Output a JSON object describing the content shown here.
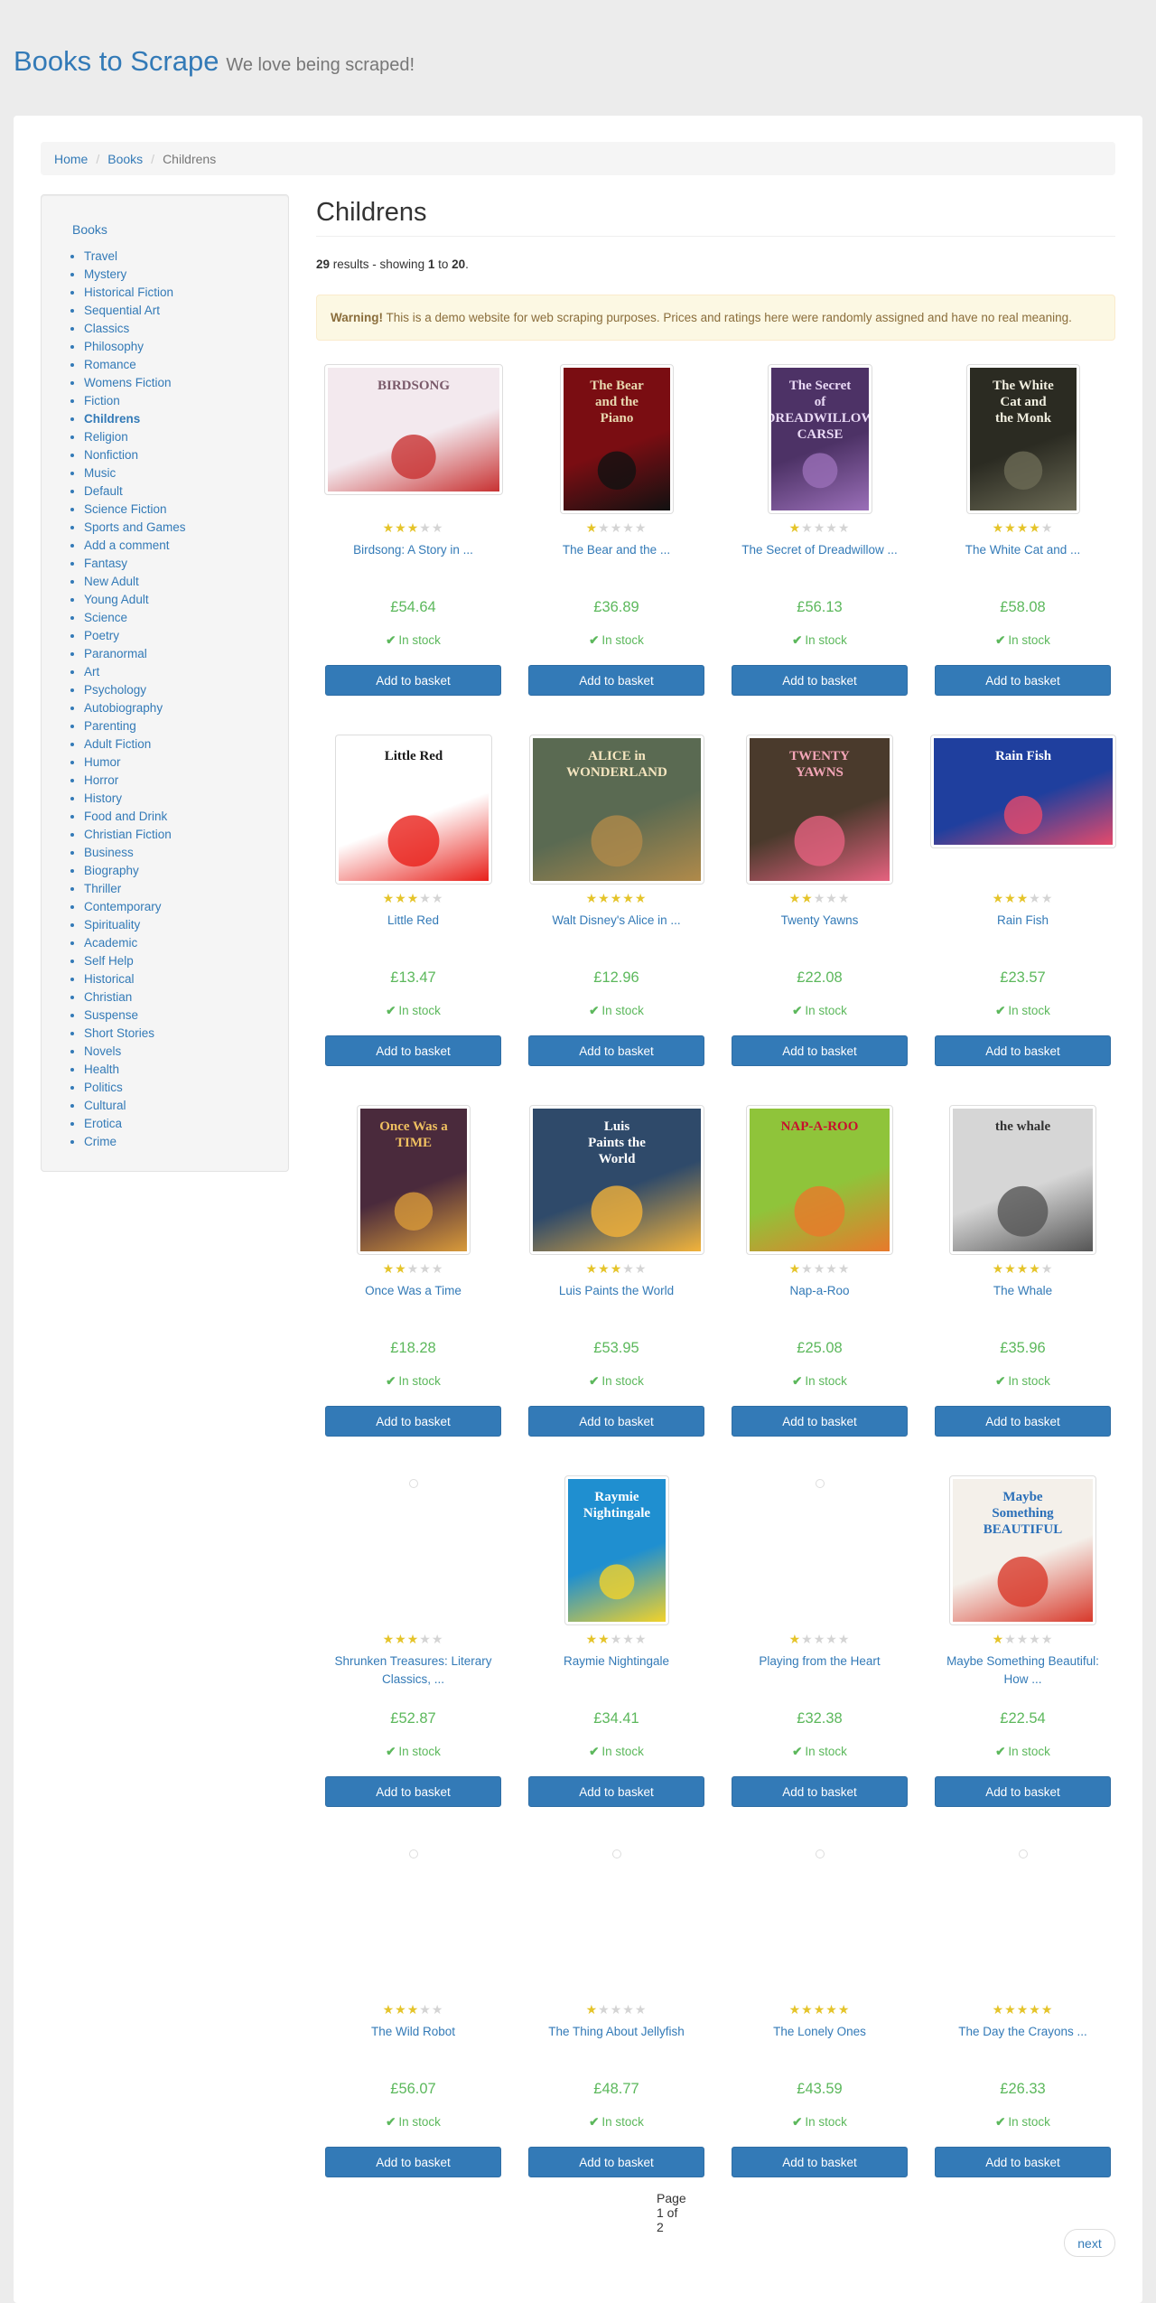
{
  "header": {
    "brand": "Books to Scrape",
    "tagline": "We love being scraped!"
  },
  "breadcrumb": {
    "home": "Home",
    "books": "Books",
    "current": "Childrens"
  },
  "sidebar": {
    "root": "Books",
    "categories": [
      "Travel",
      "Mystery",
      "Historical Fiction",
      "Sequential Art",
      "Classics",
      "Philosophy",
      "Romance",
      "Womens Fiction",
      "Fiction",
      "Childrens",
      "Religion",
      "Nonfiction",
      "Music",
      "Default",
      "Science Fiction",
      "Sports and Games",
      "Add a comment",
      "Fantasy",
      "New Adult",
      "Young Adult",
      "Science",
      "Poetry",
      "Paranormal",
      "Art",
      "Psychology",
      "Autobiography",
      "Parenting",
      "Adult Fiction",
      "Humor",
      "Horror",
      "History",
      "Food and Drink",
      "Christian Fiction",
      "Business",
      "Biography",
      "Thriller",
      "Contemporary",
      "Spirituality",
      "Academic",
      "Self Help",
      "Historical",
      "Christian",
      "Suspense",
      "Short Stories",
      "Novels",
      "Health",
      "Politics",
      "Cultural",
      "Erotica",
      "Crime"
    ],
    "current": "Childrens"
  },
  "main": {
    "title": "Childrens",
    "result_count": "29",
    "result_text_a": " results - showing ",
    "range_start": "1",
    "result_text_b": " to ",
    "range_end": "20",
    "result_text_c": ".",
    "warning_label": "Warning!",
    "warning_text": " This is a demo website for web scraping purposes. Prices and ratings here were randomly assigned and have no real meaning."
  },
  "books": [
    {
      "title": "Birdsong: A Story in ...",
      "price": "£54.64",
      "rating": 3,
      "stock": "In stock",
      "cover": {
        "bg": "#f3e9ee",
        "accent": "#c83232",
        "text": "BIRDSONG",
        "fg": "#7a5a6a"
      }
    },
    {
      "title": "The Bear and the ...",
      "price": "£36.89",
      "rating": 1,
      "stock": "In stock",
      "cover": {
        "bg": "#7a0d12",
        "accent": "#111",
        "text": "The Bear and the Piano",
        "fg": "#e8d9b0"
      }
    },
    {
      "title": "The Secret of Dreadwillow ...",
      "price": "£56.13",
      "rating": 1,
      "stock": "In stock",
      "cover": {
        "bg": "#4d3266",
        "accent": "#9a6fb8",
        "text": "The Secret of DREADWILLOW CARSE",
        "fg": "#e9d9f5"
      }
    },
    {
      "title": "The White Cat and ...",
      "price": "£58.08",
      "rating": 4,
      "stock": "In stock",
      "cover": {
        "bg": "#2b2b22",
        "accent": "#6b6a55",
        "text": "The White Cat and the Monk",
        "fg": "#f1efe0"
      }
    },
    {
      "title": "Little Red",
      "price": "£13.47",
      "rating": 3,
      "stock": "In stock",
      "cover": {
        "bg": "#ffffff",
        "accent": "#e8201a",
        "text": "Little Red",
        "fg": "#1a1a1a"
      }
    },
    {
      "title": "Walt Disney's Alice in ...",
      "price": "£12.96",
      "rating": 5,
      "stock": "In stock",
      "cover": {
        "bg": "#5a6a52",
        "accent": "#b08a4a",
        "text": "ALICE in WONDERLAND",
        "fg": "#f6e6c0"
      }
    },
    {
      "title": "Twenty Yawns",
      "price": "£22.08",
      "rating": 2,
      "stock": "In stock",
      "cover": {
        "bg": "#4a3a2c",
        "accent": "#e5627f",
        "text": "TWENTY YAWNS",
        "fg": "#f4a6b8"
      }
    },
    {
      "title": "Rain Fish",
      "price": "£23.57",
      "rating": 3,
      "stock": "In stock",
      "cover": {
        "bg": "#1f3f9e",
        "accent": "#e64a6b",
        "text": "Rain Fish",
        "fg": "#ffffff"
      }
    },
    {
      "title": "Once Was a Time",
      "price": "£18.28",
      "rating": 2,
      "stock": "In stock",
      "cover": {
        "bg": "#4a2a3c",
        "accent": "#d89a3a",
        "text": "Once Was a TIME",
        "fg": "#f0c060"
      }
    },
    {
      "title": "Luis Paints the World",
      "price": "£53.95",
      "rating": 3,
      "stock": "In stock",
      "cover": {
        "bg": "#2f4a6a",
        "accent": "#f2b23a",
        "text": "Luis Paints the World",
        "fg": "#ffffff"
      }
    },
    {
      "title": "Nap-a-Roo",
      "price": "£25.08",
      "rating": 1,
      "stock": "In stock",
      "cover": {
        "bg": "#8fc43a",
        "accent": "#e8792b",
        "text": "NAP-A-ROO",
        "fg": "#c8102e"
      }
    },
    {
      "title": "The Whale",
      "price": "£35.96",
      "rating": 4,
      "stock": "In stock",
      "cover": {
        "bg": "#d6d6d6",
        "accent": "#555555",
        "text": "the whale",
        "fg": "#333333"
      }
    },
    {
      "title": "Shrunken Treasures: Literary Classics, ...",
      "price": "£52.87",
      "rating": 3,
      "stock": "In stock",
      "cover": null
    },
    {
      "title": "Raymie Nightingale",
      "price": "£34.41",
      "rating": 2,
      "stock": "In stock",
      "cover": {
        "bg": "#1f8fd0",
        "accent": "#f2d22a",
        "text": "Raymie Nightingale",
        "fg": "#ffffff"
      }
    },
    {
      "title": "Playing from the Heart",
      "price": "£32.38",
      "rating": 1,
      "stock": "In stock",
      "cover": null
    },
    {
      "title": "Maybe Something Beautiful: How ...",
      "price": "£22.54",
      "rating": 1,
      "stock": "In stock",
      "cover": {
        "bg": "#f4f0ea",
        "accent": "#d8392b",
        "text": "Maybe Something BEAUTIFUL",
        "fg": "#2a6fb8"
      }
    },
    {
      "title": "The Wild Robot",
      "price": "£56.07",
      "rating": 3,
      "stock": "In stock",
      "cover": null
    },
    {
      "title": "The Thing About Jellyfish",
      "price": "£48.77",
      "rating": 1,
      "stock": "In stock",
      "cover": null
    },
    {
      "title": "The Lonely Ones",
      "price": "£43.59",
      "rating": 5,
      "stock": "In stock",
      "cover": null
    },
    {
      "title": "The Day the Crayons ...",
      "price": "£26.33",
      "rating": 5,
      "stock": "In stock",
      "cover": null
    }
  ],
  "basket_label": "Add to basket",
  "pager": {
    "current": "Page 1 of 2",
    "next": "next"
  },
  "colors": {
    "link": "#337ab7",
    "price": "#5cb85c",
    "star_on": "#e5c42a",
    "star_off": "#d4d4d4",
    "button": "#337ab7"
  }
}
